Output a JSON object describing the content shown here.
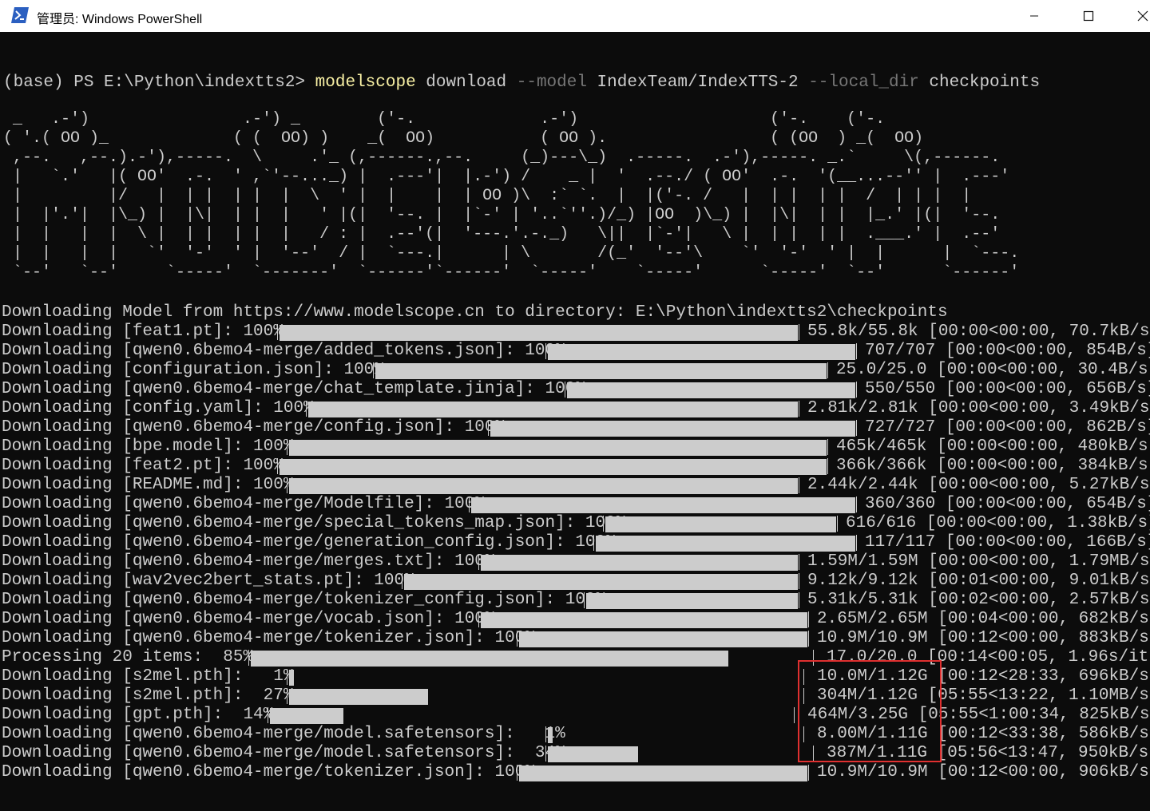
{
  "window": {
    "title": "管理员: Windows PowerShell",
    "accent_color": "#2b5fc0"
  },
  "prompt": {
    "prefix": "(base) PS E:\\Python\\indextts2> ",
    "program": "modelscope",
    "subcommand": " download ",
    "flag_model": "--model",
    "model": " IndexTeam/IndexTTS-2 ",
    "flag_dir": "--local_dir",
    "dir": " checkpoints"
  },
  "banner": " _   .-')                .-') _        ('-.             .-')                    ('-.    ('-.\n( '.( OO )_             ( (  OO) )    _(  OO)           ( OO ).                 ( (OO  ) _(  OO)\n ,--.   ,--.).-'),-----.  \\     .'_ (,------.,--.     (_)---\\_)  .-----.  .-'),-----. _.`     \\(,------.\n |   `.'   |( OO'  .-.  ' ,`'--..._) |  .---'|  |.-') /    _ |  '  .--./ ( OO'  .-.  '(__...--'' |  .---'\n |         |/   |  | |  | |  |  \\  ' |  |    |  | OO )\\  :` `.  |  |('-. /   |  | |  | |  /  | | |  |\n |  |'.'|  |\\_) |  |\\|  | |  |   ' |(|  '--. |  |`-' | '..`''.)/_) |OO  )\\_) |  |\\|  | |  |_.' |(|  '--.\n |  |   |  |  \\ |  | |  | |  |   / : |  .--'(|  '---.'.-._)   \\||  |`-'|   \\ |  | |  | |  .___.' |  .--'\n |  |   |  |   `'  '-'  ' |  '--'  / |  `---.|      | \\       /(_'  '--'\\    `'  '-'  ' |  |      |  `---.\n `--'   `--'     `-----'  `-------'  `------'`------'  `-----'    `-----'      `-----'  `--'      `------'",
  "downloads": [
    {
      "text": "Downloading Model from https://www.modelscope.cn to directory: E:\\Python\\indextts2\\checkpoints"
    },
    {
      "label": "Downloading [feat1.pt]: 100%",
      "stats": "55.8k/55.8k [00:00<00:00, 70.7kB/s]"
    },
    {
      "label": "Downloading [qwen0.6bemo4-merge/added_tokens.json]: 100%",
      "stats": "707/707 [00:00<00:00, 854B/s]"
    },
    {
      "label": "Downloading [configuration.json]: 100%",
      "stats": "25.0/25.0 [00:00<00:00, 30.4B/s]"
    },
    {
      "label": "Downloading [qwen0.6bemo4-merge/chat_template.jinja]: 100%",
      "stats": "550/550 [00:00<00:00, 656B/s]"
    },
    {
      "label": "Downloading [config.yaml]: 100%",
      "stats": "2.81k/2.81k [00:00<00:00, 3.49kB/s]"
    },
    {
      "label": "Downloading [qwen0.6bemo4-merge/config.json]: 100%",
      "stats": "727/727 [00:00<00:00, 862B/s]"
    },
    {
      "label": "Downloading [bpe.model]: 100%",
      "stats": "465k/465k [00:00<00:00, 480kB/s]"
    },
    {
      "label": "Downloading [feat2.pt]: 100%",
      "stats": "366k/366k [00:00<00:00, 384kB/s]"
    },
    {
      "label": "Downloading [README.md]: 100%",
      "stats": "2.44k/2.44k [00:00<00:00, 5.27kB/s]"
    },
    {
      "label": "Downloading [qwen0.6bemo4-merge/Modelfile]: 100%",
      "stats": "360/360 [00:00<00:00, 654B/s]"
    },
    {
      "label": "Downloading [qwen0.6bemo4-merge/special_tokens_map.json]: 100%",
      "stats": "616/616 [00:00<00:00, 1.38kB/s]"
    },
    {
      "label": "Downloading [qwen0.6bemo4-merge/generation_config.json]: 100%",
      "stats": "117/117 [00:00<00:00, 166B/s]"
    },
    {
      "label": "Downloading [qwen0.6bemo4-merge/merges.txt]: 100%",
      "stats": "1.59M/1.59M [00:00<00:00, 1.79MB/s]"
    },
    {
      "label": "Downloading [wav2vec2bert_stats.pt]: 100%",
      "stats": "9.12k/9.12k [00:01<00:00, 9.01kB/s]"
    },
    {
      "label": "Downloading [qwen0.6bemo4-merge/tokenizer_config.json]: 100%",
      "stats": "5.31k/5.31k [00:02<00:00, 2.57kB/s]"
    },
    {
      "label": "Downloading [qwen0.6bemo4-merge/vocab.json]: 100%",
      "stats": "2.65M/2.65M [00:04<00:00, 682kB/s]"
    },
    {
      "label": "Downloading [qwen0.6bemo4-merge/tokenizer.json]: 100%",
      "stats": "10.9M/10.9M [00:12<00:00, 883kB/s]"
    },
    {
      "label": "Processing 20 items:  85%",
      "stats": "17.0/20.0 [00:14<00:05, 1.96s/it]",
      "progress": 0.85
    },
    {
      "label": "Downloading [s2mel.pth]:   1%",
      "stats": "10.0M/1.12G [00:12<28:33, 696kB/s]",
      "progress": 0.01
    },
    {
      "label": "Downloading [s2mel.pth]:  27%",
      "stats": "304M/1.12G [05:55<13:22, 1.10MB/s]",
      "progress": 0.27
    },
    {
      "label": "Downloading [gpt.pth]:  14%",
      "stats": "464M/3.25G [05:55<1:00:34, 825kB/s]",
      "progress": 0.14
    },
    {
      "label": "Downloading [qwen0.6bemo4-merge/model.safetensors]:   1%",
      "stats": "8.00M/1.11G [00:12<33:38, 586kB/s]",
      "progress": 0.01
    },
    {
      "label": "Downloading [qwen0.6bemo4-merge/model.safetensors]:  34%",
      "stats": "387M/1.11G [05:56<13:47, 950kB/s]",
      "progress": 0.34
    },
    {
      "label": "Downloading [qwen0.6bemo4-merge/tokenizer.json]: 100%",
      "stats": "10.9M/10.9M [00:12<00:00, 906kB/s]"
    }
  ]
}
